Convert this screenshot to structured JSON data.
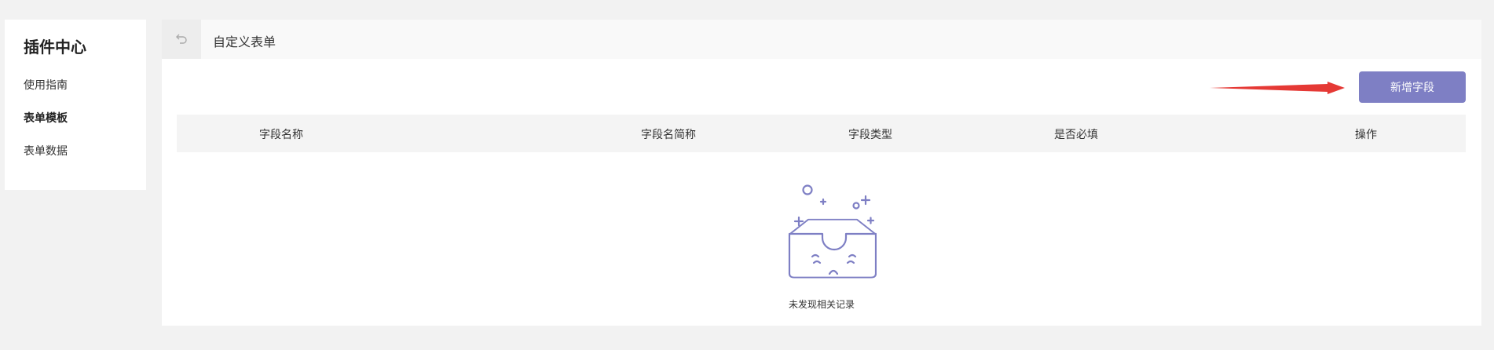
{
  "sidebar": {
    "title": "插件中心",
    "items": [
      {
        "label": "使用指南"
      },
      {
        "label": "表单模板"
      },
      {
        "label": "表单数据"
      }
    ]
  },
  "header": {
    "back_icon": "undo-arrow-icon",
    "title": "自定义表单"
  },
  "toolbar": {
    "add_label": "新增字段"
  },
  "table": {
    "columns": [
      "字段名称",
      "字段名简称",
      "字段类型",
      "是否必填",
      "操作"
    ]
  },
  "empty": {
    "icon": "empty-inbox-icon",
    "text": "未发现相关记录"
  },
  "colors": {
    "accent": "#7e7fc4",
    "arrow": "#e53935"
  }
}
